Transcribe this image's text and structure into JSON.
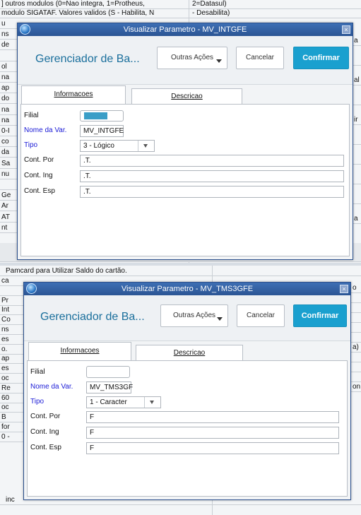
{
  "background": {
    "top_rows": [
      {
        "left": "] outros modulos (0=Nao integra, 1=Protheus,",
        "right": "2=Datasul)"
      },
      {
        "left": "modulo SIGATAF. Valores validos (S - Habilita, N",
        "right": "- Desabilita)"
      }
    ],
    "left_fragments_1": [
      "u",
      "ns",
      "de",
      "",
      "ol",
      "na",
      "ap",
      "do",
      "na",
      "na",
      "0-I",
      "co",
      "da",
      "Sa",
      "nu",
      "",
      "Ge",
      "Ar",
      "AT",
      "nt"
    ],
    "right_fragments_1": [
      "a",
      "",
      "al",
      "",
      "ir",
      "",
      "",
      "",
      "",
      "a"
    ],
    "middle_row": "Pamcard para Utilizar Saldo do cartão.",
    "left_fragments_2": [
      "ca",
      "",
      "Pr",
      "Int",
      "Co",
      "ns",
      "es",
      "o.",
      "ap",
      "es",
      "oc",
      "Re",
      "60",
      "oc",
      "B",
      "for",
      "0 -"
    ],
    "right_fragments_2": [
      "o",
      "",
      "",
      "",
      "",
      "",
      "a)",
      "",
      "",
      "",
      "on"
    ],
    "bottom_fragment": "inc"
  },
  "dialog1": {
    "title": "Visualizar Parametro - MV_INTGFE",
    "app_title": "Gerenciador de Ba...",
    "btn_outras": "Outras Ações",
    "btn_cancelar": "Cancelar",
    "btn_confirmar": "Confirmar",
    "tab_info": "Informacoes",
    "tab_desc": "Descricao",
    "labels": {
      "filial": "Filial",
      "nome": "Nome da Var.",
      "tipo": "Tipo",
      "por": "Cont. Por",
      "ing": "Cont. Ing",
      "esp": "Cont. Esp"
    },
    "values": {
      "nome": "MV_INTGFE",
      "tipo": "3 - Lógico",
      "por": ".T.",
      "ing": ".T.",
      "esp": ".T."
    }
  },
  "dialog2": {
    "title": "Visualizar Parametro - MV_TMS3GFE",
    "app_title": "Gerenciador de Ba...",
    "btn_outras": "Outras Ações",
    "btn_cancelar": "Cancelar",
    "btn_confirmar": "Confirmar",
    "tab_info": "Informacoes",
    "tab_desc": "Descricao",
    "labels": {
      "filial": "Filial",
      "nome": "Nome da Var.",
      "tipo": "Tipo",
      "por": "Cont. Por",
      "ing": "Cont. Ing",
      "esp": "Cont. Esp"
    },
    "values": {
      "nome": "MV_TMS3GF",
      "tipo": "1 - Caracter",
      "por": "F",
      "ing": "F",
      "esp": "F"
    }
  },
  "colors": {
    "title_bar": "#2b5594",
    "accent": "#1aa0cf",
    "label_blue": "#1b1bd6"
  }
}
